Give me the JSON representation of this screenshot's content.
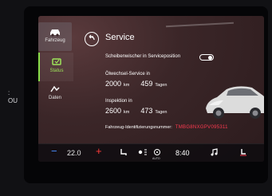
{
  "sidebar": {
    "items": [
      {
        "label": "Fahrzeug",
        "icon": "car-icon",
        "active": false
      },
      {
        "label": "Status",
        "icon": "status-icon",
        "active": true
      },
      {
        "label": "Daten",
        "icon": "data-icon",
        "active": false
      }
    ]
  },
  "left_edge_text": ":\nOU",
  "header": {
    "title": "Service"
  },
  "wiper": {
    "label": "Scheibenwischer in Serviceposition",
    "enabled": false
  },
  "oil": {
    "label": "Ölwechsel-Service in",
    "km": "2000",
    "km_unit": "km",
    "days": "459",
    "days_unit": "Tagen"
  },
  "inspection": {
    "label": "Inspektion in",
    "km": "2600",
    "km_unit": "km",
    "days": "473",
    "days_unit": "Tagen"
  },
  "vin": {
    "label": "Fahrzeug-Identifizierungsnummer:",
    "value": "TMBG8NXGPV095311"
  },
  "bottom": {
    "minus": "−",
    "temperature": "22.0",
    "plus": "+",
    "clock": "8:40",
    "seat_heat_caption": "",
    "auto_caption": "AUTO",
    "icons": [
      "seat-heat-icon",
      "fan-icon",
      "ac-icon",
      "clock-icon",
      "music-icon",
      "seat-icon"
    ],
    "accent_red": "#ff3a3a",
    "accent_blue": "#4a8cff"
  },
  "colors": {
    "active_green": "#9ee45a",
    "vin_red": "#ff3a50"
  }
}
